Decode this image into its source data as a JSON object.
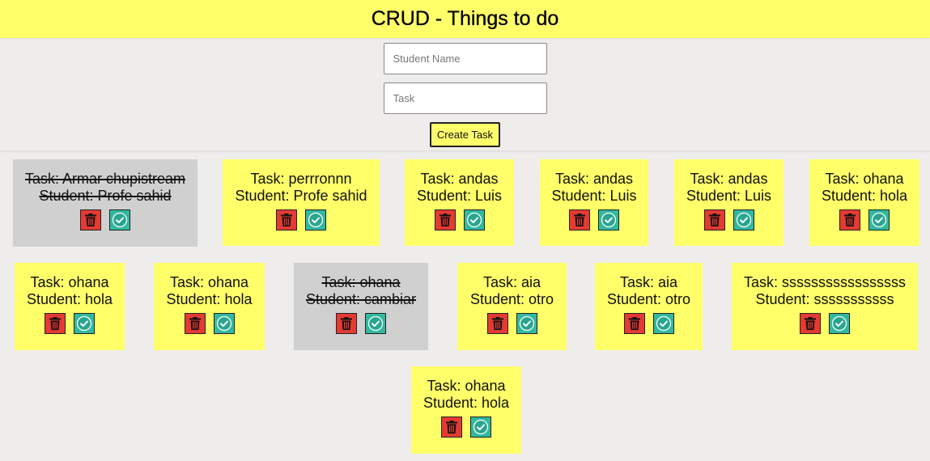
{
  "header": {
    "title": "CRUD - Things to do"
  },
  "form": {
    "student_placeholder": "Student Name",
    "task_placeholder": "Task",
    "create_label": "Create Task"
  },
  "icons": {
    "delete": "trash-icon",
    "complete": "check-circle-icon"
  },
  "colors": {
    "note": "#ffff6a",
    "done_note": "#cfd0cf",
    "delete": "#e53a33",
    "complete": "#33b8a0"
  },
  "tasks": [
    {
      "task": "Task: Armar chupistream",
      "student": "Student: Profe sahid",
      "done": true
    },
    {
      "task": "Task: perrronnn",
      "student": "Student: Profe sahid",
      "done": false
    },
    {
      "task": "Task: andas",
      "student": "Student: Luis",
      "done": false
    },
    {
      "task": "Task: andas",
      "student": "Student: Luis",
      "done": false
    },
    {
      "task": "Task: andas",
      "student": "Student: Luis",
      "done": false
    },
    {
      "task": "Task: ohana",
      "student": "Student: hola",
      "done": false
    },
    {
      "task": "Task: ohana",
      "student": "Student: hola",
      "done": false
    },
    {
      "task": "Task: ohana",
      "student": "Student: hola",
      "done": false
    },
    {
      "task": "Task: ohana",
      "student": "Student: cambiar",
      "done": true
    },
    {
      "task": "Task: aia",
      "student": "Student: otro",
      "done": false
    },
    {
      "task": "Task: aia",
      "student": "Student: otro",
      "done": false
    },
    {
      "task": "Task: sssssssssssssssss",
      "student": "Student: sssssssssss",
      "done": false
    },
    {
      "task": "Task: ohana",
      "student": "Student: hola",
      "done": false
    }
  ]
}
